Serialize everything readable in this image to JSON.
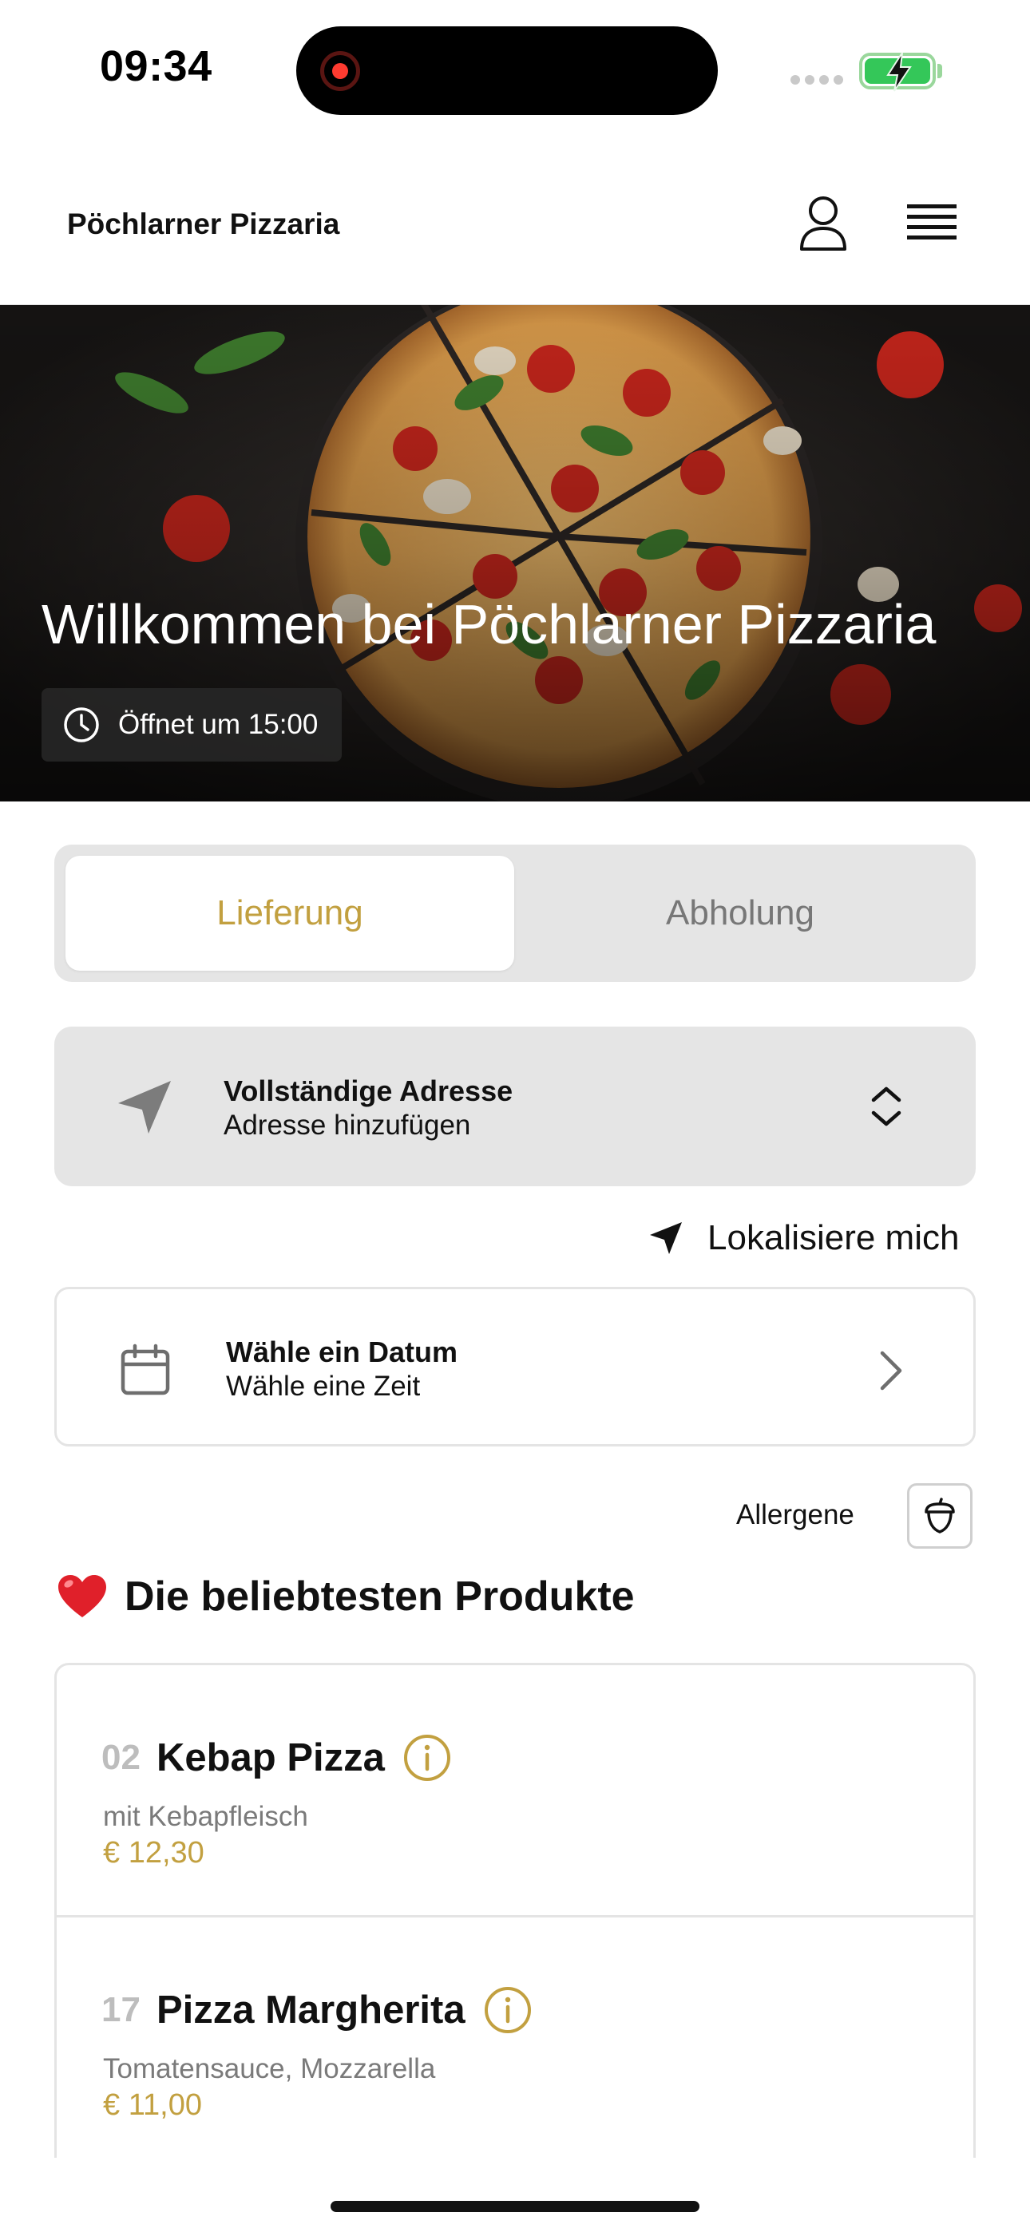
{
  "status_bar": {
    "time": "09:34"
  },
  "header": {
    "brand": "Pöchlarner Pizzaria",
    "icons": [
      "user-icon",
      "menu-icon"
    ]
  },
  "hero": {
    "title": "Willkommen bei Pöchlarner Pizzaria",
    "hours": "Öffnet um 15:00"
  },
  "order_mode": {
    "delivery": "Lieferung",
    "pickup": "Abholung",
    "selected": "Lieferung"
  },
  "address": {
    "title": "Vollständige Adresse",
    "subtitle": "Adresse hinzufügen"
  },
  "locate": {
    "label": "Lokalisiere mich"
  },
  "schedule": {
    "title": "Wähle ein Datum",
    "subtitle": "Wähle eine Zeit"
  },
  "allergens": {
    "label": "Allergene"
  },
  "popular": {
    "emoji": "❤️",
    "title": "Die beliebtesten Produkte",
    "products": [
      {
        "number": "02",
        "name": "Kebap Pizza",
        "description": "mit Kebapfleisch",
        "price": "€ 12,30"
      },
      {
        "number": "17",
        "name": "Pizza Margherita",
        "description": "Tomatensauce, Mozzarella",
        "price": "€ 11,00"
      }
    ]
  },
  "colors": {
    "accent": "#c2a040",
    "battery": "#34c759",
    "segment_bg": "#e5e5e5"
  }
}
